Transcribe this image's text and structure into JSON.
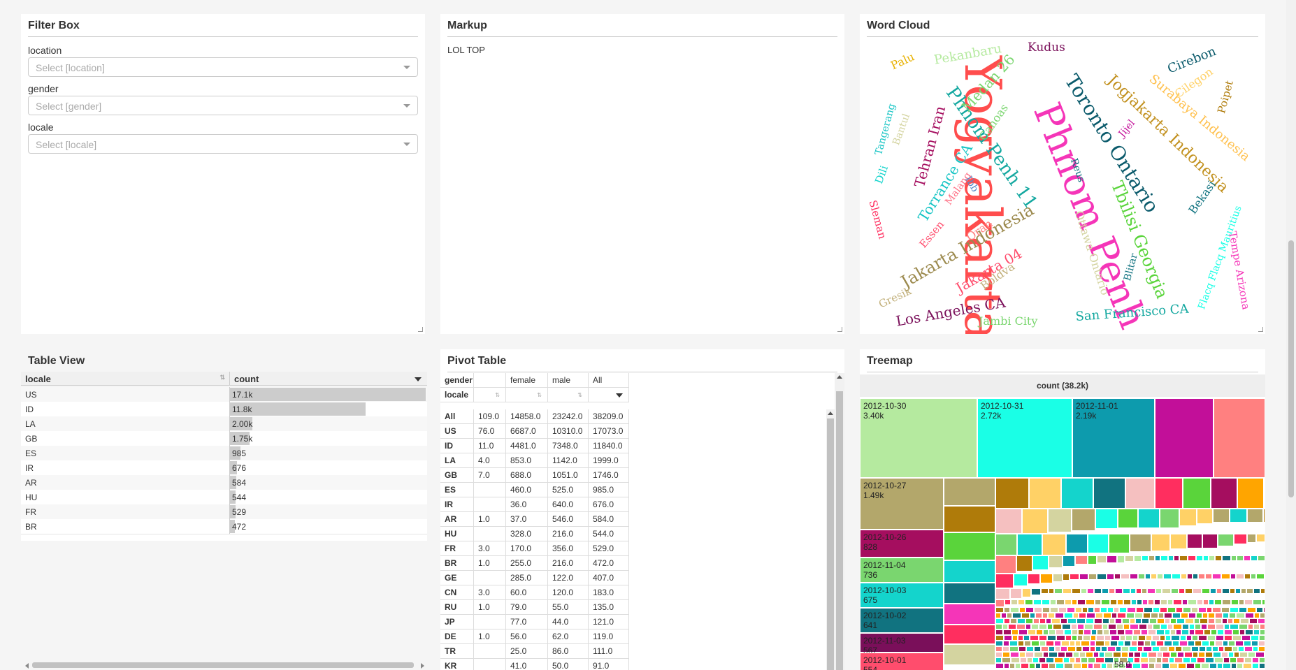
{
  "filter_box": {
    "title": "Filter Box",
    "filters": [
      {
        "label": "location",
        "placeholder": "Select [location]"
      },
      {
        "label": "gender",
        "placeholder": "Select [gender]"
      },
      {
        "label": "locale",
        "placeholder": "Select [locale]"
      }
    ]
  },
  "markup": {
    "title": "Markup",
    "text": "LOL TOP"
  },
  "word_cloud": {
    "title": "Word Cloud",
    "words": [
      "Yogyakarta",
      "Phnom Penh",
      "Toronto Ontario",
      "Jogjakarta Indonesia",
      "Phnom Penh 11",
      "Jakarta Indonesia",
      "Tbilisi Georgia",
      "Los Angeles CA",
      "San Francisco CA",
      "Surabaya Indonesia",
      "Jakarta 04",
      "Tehran Iran",
      "Torrance CA",
      "Medan 26",
      "Pekanbaru",
      "Kudus",
      "Cirebon",
      "Cilegon",
      "Poipet",
      "Palu",
      "Tangerang",
      "Bantul",
      "Canoas",
      "Bekasi",
      "Flacq Flacq Mauritius",
      "Tempe Arizona",
      "Ottawa Ontario",
      "Jambi City",
      "Gresik",
      "Boldva",
      "Blitar",
      "Reus",
      "Jijel",
      "Malang",
      "Oran",
      "Essen",
      "Sleman",
      "Dili",
      "Ibb"
    ]
  },
  "table_view": {
    "title": "Table View",
    "columns": [
      "locale",
      "count"
    ],
    "rows": [
      {
        "locale": "US",
        "count": "17.1k",
        "value": 17073
      },
      {
        "locale": "ID",
        "count": "11.8k",
        "value": 11840
      },
      {
        "locale": "LA",
        "count": "2.00k",
        "value": 1999
      },
      {
        "locale": "GB",
        "count": "1.75k",
        "value": 1746
      },
      {
        "locale": "ES",
        "count": "985",
        "value": 985
      },
      {
        "locale": "IR",
        "count": "676",
        "value": 676
      },
      {
        "locale": "AR",
        "count": "584",
        "value": 584
      },
      {
        "locale": "HU",
        "count": "544",
        "value": 544
      },
      {
        "locale": "FR",
        "count": "529",
        "value": 529
      },
      {
        "locale": "BR",
        "count": "472",
        "value": 472
      }
    ]
  },
  "pivot_table": {
    "title": "Pivot Table",
    "header1": [
      "gender",
      "",
      "female",
      "male",
      "All"
    ],
    "header2": "locale",
    "rows": [
      [
        "All",
        "109.0",
        "14858.0",
        "23242.0",
        "38209.0"
      ],
      [
        "US",
        "76.0",
        "6687.0",
        "10310.0",
        "17073.0"
      ],
      [
        "ID",
        "11.0",
        "4481.0",
        "7348.0",
        "11840.0"
      ],
      [
        "LA",
        "4.0",
        "853.0",
        "1142.0",
        "1999.0"
      ],
      [
        "GB",
        "7.0",
        "688.0",
        "1051.0",
        "1746.0"
      ],
      [
        "ES",
        "",
        "460.0",
        "525.0",
        "985.0"
      ],
      [
        "IR",
        "",
        "36.0",
        "640.0",
        "676.0"
      ],
      [
        "AR",
        "1.0",
        "37.0",
        "546.0",
        "584.0"
      ],
      [
        "HU",
        "",
        "328.0",
        "216.0",
        "544.0"
      ],
      [
        "FR",
        "3.0",
        "170.0",
        "356.0",
        "529.0"
      ],
      [
        "BR",
        "1.0",
        "255.0",
        "216.0",
        "472.0"
      ],
      [
        "GE",
        "",
        "285.0",
        "122.0",
        "407.0"
      ],
      [
        "CN",
        "3.0",
        "60.0",
        "120.0",
        "183.0"
      ],
      [
        "RU",
        "1.0",
        "79.0",
        "55.0",
        "135.0"
      ],
      [
        "JP",
        "",
        "77.0",
        "44.0",
        "121.0"
      ],
      [
        "DE",
        "1.0",
        "56.0",
        "62.0",
        "119.0"
      ],
      [
        "TR",
        "",
        "25.0",
        "86.0",
        "111.0"
      ],
      [
        "KR",
        "",
        "41.0",
        "50.0",
        "91.0"
      ]
    ]
  },
  "treemap": {
    "title": "Treemap",
    "root_label": "count (38.2k)",
    "items": [
      {
        "date": "2012-10-30",
        "count": "3.40k"
      },
      {
        "date": "2012-10-31",
        "count": "2.72k"
      },
      {
        "date": "2012-11-01",
        "count": "2.19k"
      },
      {
        "date": "2012-10-27",
        "count": "1.49k"
      },
      {
        "date": "2012-10-26",
        "count": "828"
      },
      {
        "date": "2012-11-04",
        "count": "736"
      },
      {
        "date": "2012-10-03",
        "count": "675"
      },
      {
        "date": "2012-10-02",
        "count": "641"
      },
      {
        "date": "2012-11-03",
        "count": "567"
      },
      {
        "date": "2012-10-01",
        "count": "554"
      }
    ],
    "small_label": "58.0",
    "colors": [
      "#b5ea9f",
      "#1affe6",
      "#0d9bad",
      "#c20f99",
      "#ff8080",
      "#b3a76b",
      "#af7b0a",
      "#ffd166",
      "#14d4cc",
      "#117380",
      "#f5c0c0",
      "#ff2e5f",
      "#5ad43b",
      "#a50e5f",
      "#ffa500",
      "#d4d4a0",
      "#7ad66f",
      "#f535b8"
    ]
  }
}
